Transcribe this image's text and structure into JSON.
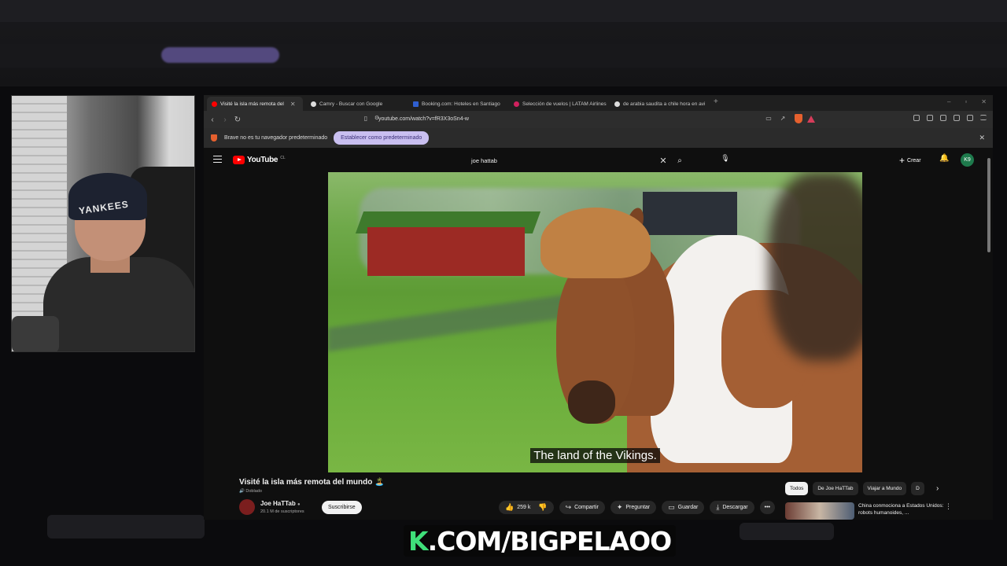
{
  "browser": {
    "tabs": [
      {
        "title": "Visité la isla más remota del",
        "active": true,
        "favicon_color": "#ff0000"
      },
      {
        "title": "Camry - Buscar con Google",
        "active": false,
        "favicon_color": "#dddddd"
      },
      {
        "title": "Booking.com: Hoteles en Santiago",
        "active": false,
        "favicon_color": "#2f5fd0"
      },
      {
        "title": "Selección de vuelos | LATAM Airlines",
        "active": false,
        "favicon_color": "#d0215e"
      },
      {
        "title": "de arabia saudita a chile hora en avi",
        "active": false,
        "favicon_color": "#dddddd"
      }
    ],
    "url": "youtube.com/watch?v=fR3X3oSn4-w",
    "infobar": {
      "message": "Brave no es tu navegador predeterminado",
      "button": "Establecer como predeterminado"
    }
  },
  "youtube": {
    "logo": "YouTube",
    "region": "CL",
    "search_query": "joe hattab",
    "create_label": "Crear",
    "avatar_initials": "K9",
    "subtitle": "The land of the Vikings.",
    "video_title": "Visité la isla más remota del mundo 🏝️",
    "dubbed_label": "Doblado",
    "channel_name": "Joe HaTTab",
    "subscribers": "20.1 M de suscriptores",
    "subscribe_label": "Suscribirse",
    "likes": "259 k",
    "actions": [
      "Compartir",
      "Preguntar",
      "Guardar",
      "Descargar"
    ],
    "chips": [
      "Todos",
      "De Joe HaTTab",
      "Viajar a Mundo",
      "D"
    ],
    "recommendation_title": "China conmociona a Estados Unidos: robots humanoides, ..."
  },
  "overlay": {
    "k": "K",
    "text": ".COM/BIGPELAOO"
  },
  "webcam": {
    "cap_text": "YANKEES"
  }
}
